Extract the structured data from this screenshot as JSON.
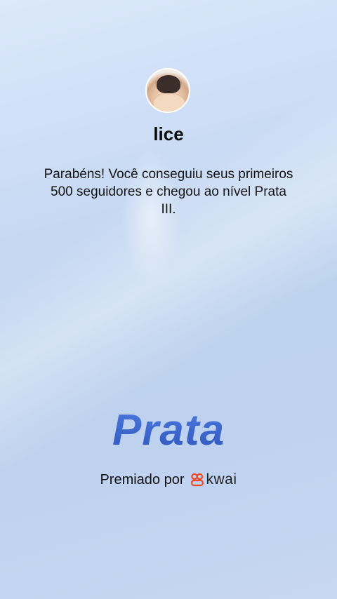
{
  "profile": {
    "username": "lice",
    "avatar_icon": "profile-photo"
  },
  "message": "Parabéns! Você conseguiu seus primeiros 500 seguidores e chegou ao nível Prata III.",
  "tier": {
    "label": "Prata",
    "color": "#3a63c8"
  },
  "award": {
    "prefix": "Premiado por",
    "brand_name": "kwai",
    "brand_icon": "kwai-logo-icon",
    "brand_color": "#f04a1f"
  }
}
